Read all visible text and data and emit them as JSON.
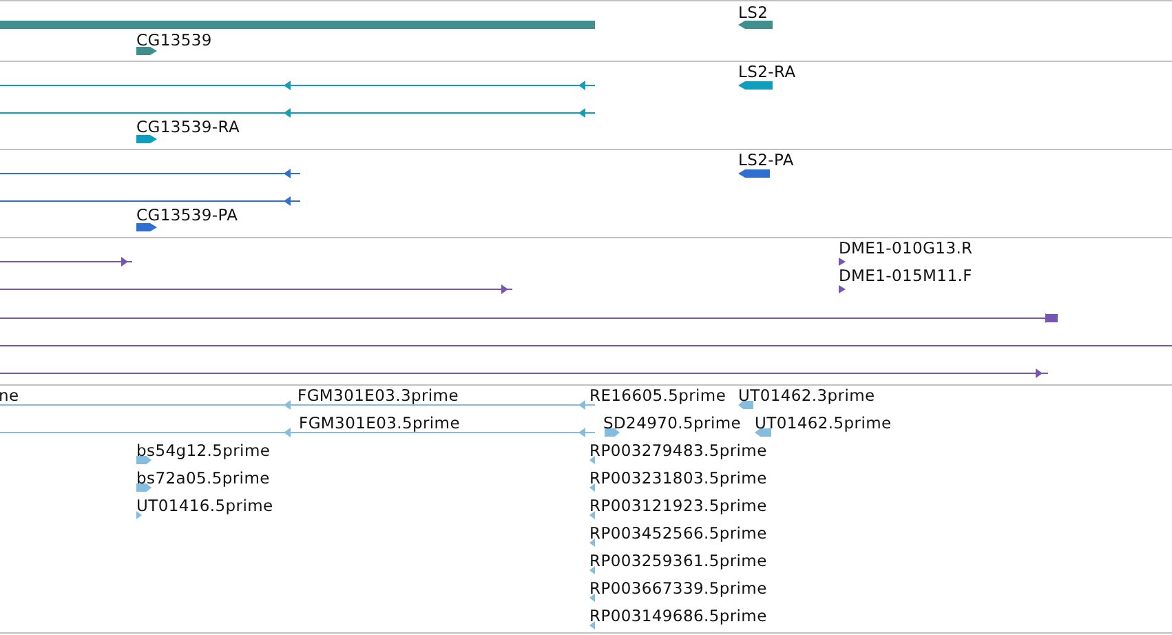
{
  "tracks": [
    {
      "color": "#3f8f8f",
      "features": [
        {
          "kind": "bar"
        },
        {
          "kind": "block",
          "label": "CG13539",
          "reverse": false
        },
        {
          "kind": "block",
          "label": "LS2",
          "reverse": true
        }
      ]
    },
    {
      "color": "#0e9fbf",
      "features": [
        {
          "kind": "line",
          "reverse": true
        },
        {
          "kind": "line",
          "reverse": true
        },
        {
          "kind": "block",
          "label": "CG13539-RA",
          "reverse": false
        },
        {
          "kind": "block",
          "label": "LS2-RA",
          "reverse": true
        }
      ]
    },
    {
      "color": "#2f6fcf",
      "features": [
        {
          "kind": "line",
          "reverse": true
        },
        {
          "kind": "line",
          "reverse": true
        },
        {
          "kind": "block",
          "label": "CG13539-PA",
          "reverse": false
        },
        {
          "kind": "block",
          "label": "LS2-PA",
          "reverse": true
        }
      ]
    },
    {
      "color": "#7656b0",
      "features": [
        {
          "kind": "line",
          "reverse": false
        },
        {
          "kind": "line",
          "reverse": false
        },
        {
          "kind": "line",
          "reverse": false
        },
        {
          "kind": "line"
        },
        {
          "kind": "line",
          "reverse": false
        },
        {
          "kind": "block",
          "label": "DME1-010G13.R",
          "reverse": false
        },
        {
          "kind": "block",
          "label": "DME1-015M11.F",
          "reverse": false
        }
      ]
    },
    {
      "color": "#84bde0",
      "features": [
        {
          "kind": "line",
          "label": "ne",
          "reverse": true
        },
        {
          "label": "FGM301E03.3prime"
        },
        {
          "kind": "line",
          "reverse": true
        },
        {
          "label": "FGM301E03.5prime"
        },
        {
          "label": "RE16605.5prime"
        },
        {
          "kind": "block",
          "label": "UT01462.3prime",
          "reverse": true
        },
        {
          "kind": "block",
          "label": "SD24970.5prime",
          "reverse": false
        },
        {
          "kind": "block",
          "label": "UT01462.5prime",
          "reverse": true
        },
        {
          "kind": "block",
          "label": "bs54g12.5prime",
          "reverse": false
        },
        {
          "kind": "block",
          "label": "bs72a05.5prime",
          "reverse": false
        },
        {
          "kind": "block",
          "label": "UT01416.5prime",
          "reverse": false
        },
        {
          "kind": "block",
          "label": "RP003279483.5prime",
          "reverse": true
        },
        {
          "kind": "block",
          "label": "RP003231803.5prime",
          "reverse": true
        },
        {
          "kind": "block",
          "label": "RP003121923.5prime",
          "reverse": true
        },
        {
          "kind": "block",
          "label": "RP003452566.5prime",
          "reverse": true
        },
        {
          "kind": "block",
          "label": "RP003259361.5prime",
          "reverse": true
        },
        {
          "kind": "block",
          "label": "RP003667339.5prime",
          "reverse": true
        },
        {
          "kind": "block",
          "label": "RP003149686.5prime",
          "reverse": true
        }
      ]
    }
  ]
}
